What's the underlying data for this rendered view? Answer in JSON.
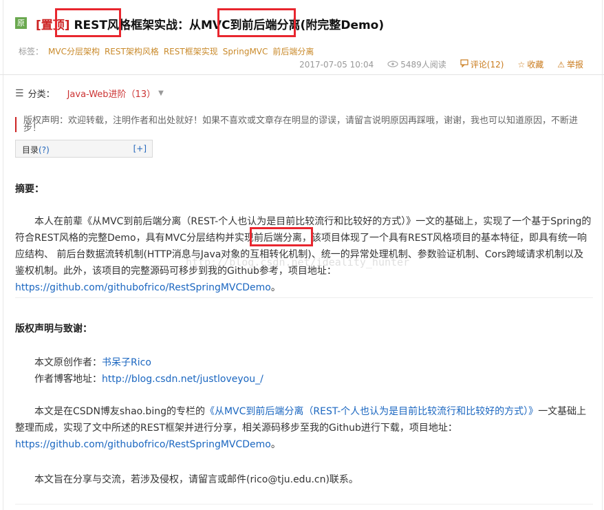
{
  "header": {
    "badge": "原",
    "pin": "[置顶]",
    "title": "REST风格框架实战：从MVC到前后端分离(附完整Demo)",
    "tags_label": "标签：",
    "tags": [
      "MVC分层架构",
      "REST架构风格",
      "REST框架实现",
      "SpringMVC",
      "前后端分离"
    ],
    "date": "2017-07-05 10:04",
    "views": "5489人阅读",
    "comments": "评论(12)",
    "favorite": "收藏",
    "report": "举报"
  },
  "category": {
    "label": "分类：",
    "value": "Java-Web进阶（13）"
  },
  "copyright_notice": "版权声明：欢迎转载，注明作者和出处就好！如果不喜欢或文章存在明显的谬误，请留言说明原因再踩哦，谢谢，我也可以知道原因，不断进步！",
  "toc": {
    "label": "目录",
    "help": "(?)",
    "toggle": "[+]"
  },
  "abstract": {
    "heading": "摘要：",
    "text": "本人在前辈《从MVC到前后端分离（REST-个人也认为是目前比较流行和比较好的方式）》一文的基础上，实现了一个基于Spring的符合REST风格的完整Demo，具有MVC分层结构并实现前后端分离，该项目体现了一个具有REST风格项目的基本特征，即具有统一响应结构、 前后台数据流转机制(HTTP消息与Java对象的互相转化机制)、统一的异常处理机制、参数验证机制、Cors跨域请求机制以及鉴权机制。此外，该项目的完整源码可移步到我的Github参考，项目地址：",
    "link": "https://github.com/githubofrico/RestSpringMVCDemo",
    "end": "。"
  },
  "watermark": "http://blog.csdn.net/ideality_hunter",
  "credits": {
    "heading": "版权声明与致谢：",
    "author_label": "本文原创作者：",
    "author": "书呆子Rico",
    "blog_label": "作者博客地址：",
    "blog": "http://blog.csdn.net/justloveyou_/",
    "para1_start": "本文是在CSDN博友shao.bing的专栏的",
    "para1_link": "《从MVC到前后端分离（REST-个人也认为是目前比较流行和比较好的方式）》",
    "para1_mid": "一文基础上整理而成，实现了文中所述的REST框架并进行分享，相关源码移步至我的Github进行下载，项目地址：",
    "para1_url": "https://github.com/githubofrico/RestSpringMVCDemo",
    "para1_end": "。",
    "para2": "本文旨在分享与交流，若涉及侵权，请留言或邮件(rico@tju.edu.cn)联系。"
  },
  "colors": {
    "pin": "#cc2222",
    "tag": "#c98a2b",
    "link": "#1a66c0",
    "highlight_box": "#e8262e",
    "badge": "#6aa84f"
  }
}
